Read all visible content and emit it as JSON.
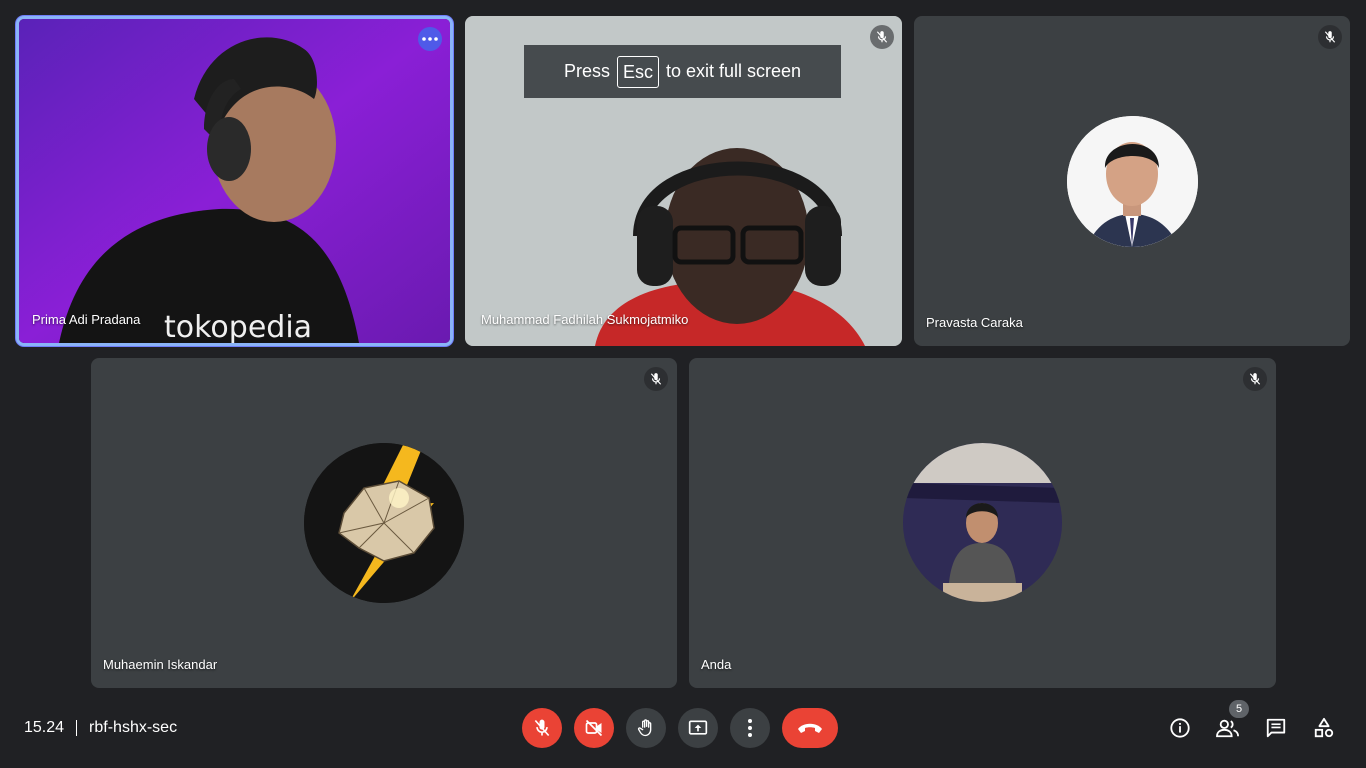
{
  "app": "Google Meet",
  "colors": {
    "background": "#202124",
    "tile": "#3c4043",
    "danger": "#ea4335",
    "active_border": "#8ab4f8"
  },
  "toast": {
    "press": "Press",
    "key": "Esc",
    "suffix": "to exit full screen"
  },
  "participants": [
    {
      "name": "Prima Adi Pradana",
      "state": "video",
      "active_speaker": true
    },
    {
      "name": "Muhammad Fadhilah Sukmojatmiko",
      "state": "video",
      "muted": true
    },
    {
      "name": "Pravasta Caraka",
      "state": "avatar",
      "muted": true
    },
    {
      "name": "Muhaemin Iskandar",
      "state": "avatar",
      "muted": true
    },
    {
      "name": "Anda",
      "state": "avatar",
      "muted": true
    }
  ],
  "footer": {
    "time": "15.24",
    "meeting_code": "rbf-hshx-sec",
    "participant_count": "5",
    "controls": [
      "mic-off",
      "camera-off",
      "raise-hand",
      "present",
      "more-options",
      "leave-call"
    ],
    "right_icons": [
      "info",
      "people",
      "chat",
      "activities"
    ]
  }
}
